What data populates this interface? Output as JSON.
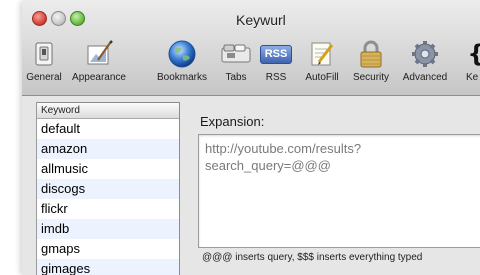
{
  "window": {
    "title": "Keywurl"
  },
  "toolbar": {
    "items": [
      {
        "label": "General",
        "icon": "general-switch-icon"
      },
      {
        "label": "Appearance",
        "icon": "appearance-brush-icon"
      },
      {
        "label": "Bookmarks",
        "icon": "bookmarks-globe-icon"
      },
      {
        "label": "Tabs",
        "icon": "tabs-icon"
      },
      {
        "label": "RSS",
        "icon": "rss-icon",
        "badge": "RSS"
      },
      {
        "label": "AutoFill",
        "icon": "autofill-pencil-icon"
      },
      {
        "label": "Security",
        "icon": "security-lock-icon"
      },
      {
        "label": "Advanced",
        "icon": "advanced-gear-icon"
      },
      {
        "label": "Ke",
        "icon": "keywurl-icon"
      }
    ]
  },
  "keywords": {
    "header": "Keyword",
    "rows": [
      "default",
      "amazon",
      "allmusic",
      "discogs",
      "flickr",
      "imdb",
      "gmaps",
      "gimages"
    ]
  },
  "expansion": {
    "label": "Expansion:",
    "value": "http://youtube.com/results?\nsearch_query=@@@"
  },
  "hint": "@@@ inserts query, $$$ inserts everything typed",
  "colors": {
    "alt_row": "#edf3fe",
    "close": "#d9453b",
    "minimize": "#c9c9c9",
    "zoom": "#6bbf45",
    "rss_badge": "#5a7fc4"
  }
}
